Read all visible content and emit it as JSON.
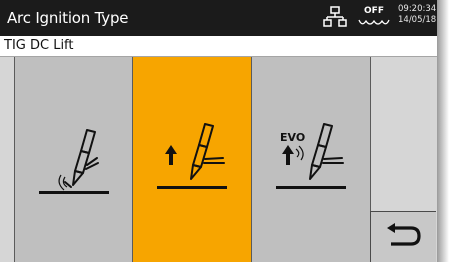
{
  "header": {
    "title": "Arc Ignition Type",
    "network_icon": "network-icon",
    "status_label": "OFF",
    "status_icon": "water-wave-icon",
    "time": "09:20:34",
    "date": "14/05/18"
  },
  "subheader": {
    "mode": "TIG DC Lift"
  },
  "options": [
    {
      "id": "scratch",
      "icon": "scratch-start-torch-icon",
      "selected": false
    },
    {
      "id": "lift",
      "icon": "lift-arc-torch-icon",
      "selected": true
    },
    {
      "id": "evo",
      "label": "EVO",
      "icon": "evo-lift-torch-icon",
      "selected": false
    }
  ],
  "back_button": {
    "icon": "return-arrow-icon"
  },
  "colors": {
    "header_bg": "#1b1b1b",
    "selected_bg": "#f7a500",
    "option_bg": "#bfbfbf",
    "panel_bg": "#d6d6d6"
  }
}
